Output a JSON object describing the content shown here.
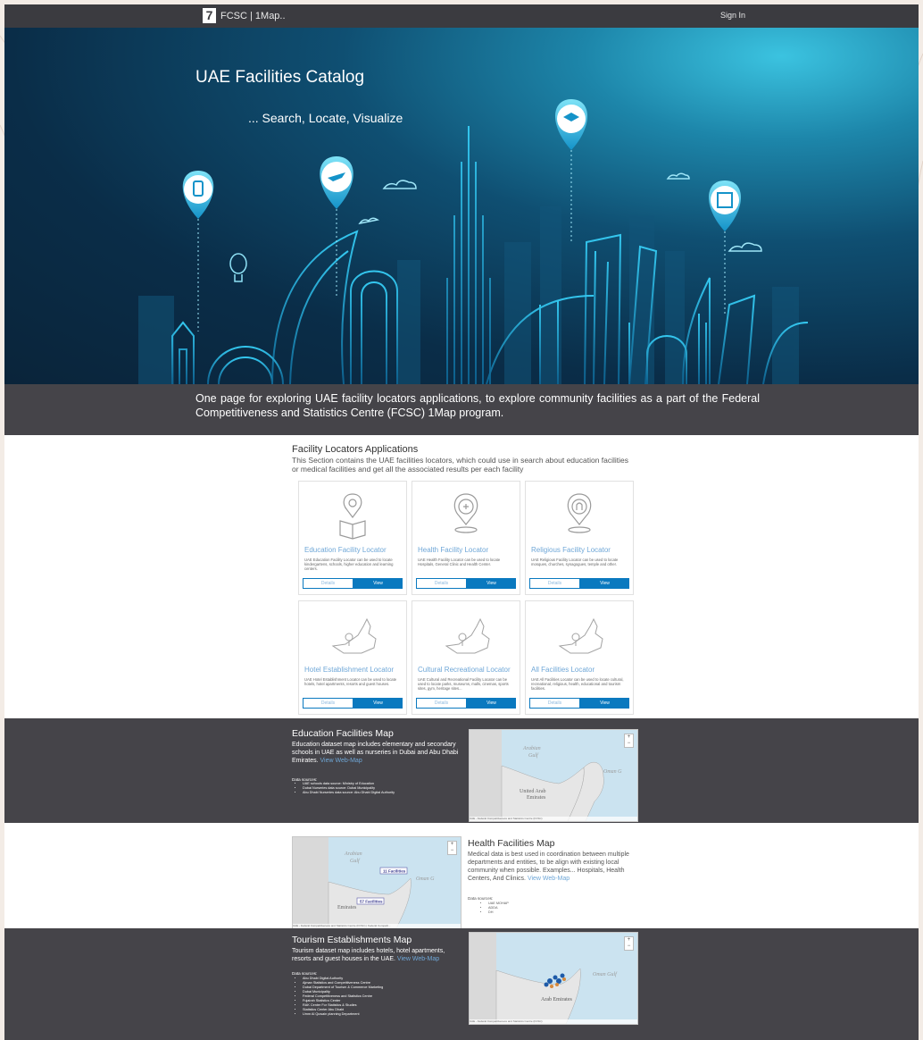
{
  "topbar": {
    "brand_text": "FCSC | 1Map..",
    "signin_label": "Sign In",
    "logo_glyph": "7"
  },
  "hero": {
    "title": "UAE Facilities Catalog",
    "subtitle": "... Search, Locate, Visualize"
  },
  "intro": {
    "text": "One page for exploring UAE facility locators applications, to explore community facilities as a part of the Federal Competitiveness and Statistics Centre (FCSC) 1Map program."
  },
  "facility_section": {
    "title": "Facility Locators Applications",
    "description": "This Section contains the UAE facilities locators, which could use in search about education facilities or medical facilities and get all the associated results per each facility",
    "cards": [
      {
        "title": "Education Facility Locator",
        "desc": "UAE Education Facility Locator can be used to locate kindergartens, schools, higher education and learning centers.",
        "details": "Details",
        "view": "View",
        "icon": "map-pin-book-icon"
      },
      {
        "title": "Health Facility Locator",
        "desc": "UAE Health Facility Locator can be used to locate Hospitals, General Clinic and Health Center.",
        "details": "Details",
        "view": "View",
        "icon": "map-pin-medical-icon"
      },
      {
        "title": "Religious Facility Locator",
        "desc": "UAE Religious Facility Locator can be used to locate mosques, churches, synagogues, temple and other.",
        "details": "Details",
        "view": "View",
        "icon": "map-pin-religious-icon"
      },
      {
        "title": "Hotel Establishment Locator",
        "desc": "UAE Hotel Establishment Locator can be used to locate hotels, hotel apartments, resorts and guest houses.",
        "details": "Details",
        "view": "View",
        "icon": "uae-map-pin-icon"
      },
      {
        "title": "Cultural Recreational Locator",
        "desc": "UAE Cultural and Recreational Facility Locator can be used to locate parks, museums, malls, cinemas, sports sites, gym, heritage sites...",
        "details": "Details",
        "view": "View",
        "icon": "uae-map-pin-icon"
      },
      {
        "title": "All Facilities Locator",
        "desc": "UAE All Facilities Locator can be used to locate cultural, recreational, religious, health, educational and tourism facilities.",
        "details": "Details",
        "view": "View",
        "icon": "uae-map-pin-icon"
      }
    ]
  },
  "education_map": {
    "title": "Education Facilities Map",
    "desc": "Education dataset map includes elementary and secondary schools in UAE as well as nurseries in Dubai and Abu Dhabi Emirates.",
    "link": "View Web-Map",
    "sources_title": "Data sources:",
    "sources": [
      "UAE schools data source: Ministry of Education",
      "Dubai Nurseries data source: Dubai Municipality",
      "Abu Dhabi Nurseries data source: Abu Dhabi Digital Authority"
    ],
    "map_labels": [
      "Arabian",
      "Gulf",
      "Oman G",
      "United Arab",
      "Emirates"
    ],
    "attribution": "UAE - Federal Competitiveness and Statistics Centre (FCSC)",
    "powered": "Powered by Esri"
  },
  "health_map": {
    "title": "Health Facilities Map",
    "desc": "Medical data is best used in coordination between multiple departments and entities, to be align with existing local community when possible. Examples... Hospitals, Health Centers, And Clinics.",
    "link": "View Web-Map",
    "sources_title": "Data sources:",
    "sources": [
      "UAE MOHAP",
      "ADDA",
      "DH"
    ],
    "map_labels": [
      "Arabian",
      "Gulf",
      "Oman G",
      "Emirates"
    ],
    "clusters": [
      "11 Facilities",
      "57 Facilities"
    ],
    "attribution": "UAE - Federal Competitiveness and Statistics Centre (FCSC) | Federal Competit...",
    "powered": "Powered by Esri"
  },
  "tourism_map": {
    "title": "Tourism Establishments Map",
    "desc": "Tourism dataset map includes hotels, hotel apartments, resorts and guest houses in the UAE.",
    "link": "View Web-Map",
    "sources_title": "Data sources:",
    "sources": [
      "Abu Dhabi Digital Authority",
      "Ajman Statistics and Competitiveness Centre",
      "Dubai Department of Tourism & Commerce Marketing",
      "Dubai Municipality",
      "Federal Competitiveness and Statistics Centre",
      "Fujairah Statistics Center",
      "RAK Center For Statistics & Studies",
      "Statistics Center Abu Dhabi",
      "Umm Al Quwain planning Department"
    ],
    "map_labels": [
      "Oman Gulf",
      "Arab Emirates"
    ],
    "attribution": "UAE - Federal Competitiveness and Statistics Centre (FCSC)",
    "powered": "Powered by Esri"
  },
  "colors": {
    "topbar": "#3b3b40",
    "band_dark": "#454449",
    "accent_blue": "#0a79bf",
    "link_blue": "#6fa7d7"
  }
}
